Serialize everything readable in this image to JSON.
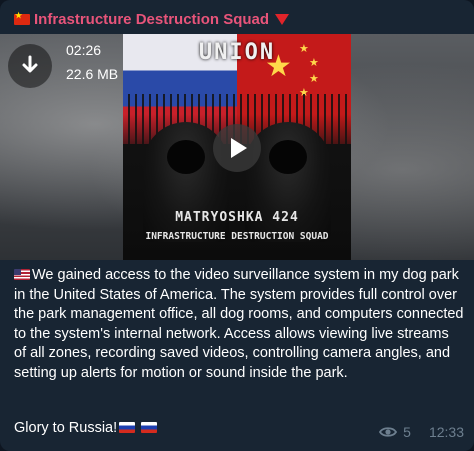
{
  "channel": {
    "name": "Infrastructure Destruction Squad",
    "name_color": "#e8547a"
  },
  "media": {
    "duration": "02:26",
    "size": "22.6 MB",
    "cover": {
      "title": "UNION",
      "name": "MATRYOSHKA 424",
      "subtitle": "INFRASTRUCTURE DESTRUCTION SQUAD"
    },
    "download_icon": "download-arrow-icon",
    "play_icon": "play-icon"
  },
  "message": {
    "body": "We gained access to the video surveillance system in my dog park in the United States of America. The system provides full control over the park management office, all dog rooms, and computers connected to the system's internal network. Access allows viewing live streams of all zones, recording saved videos, controlling camera angles, and setting up alerts for motion or sound inside the park.",
    "closing": "Glory to Russia!"
  },
  "meta": {
    "views": "5",
    "time": "12:33",
    "views_icon": "eye-icon"
  },
  "colors": {
    "bubble_bg": "#182533",
    "text": "#ffffff",
    "meta": "#6d7f8f"
  }
}
